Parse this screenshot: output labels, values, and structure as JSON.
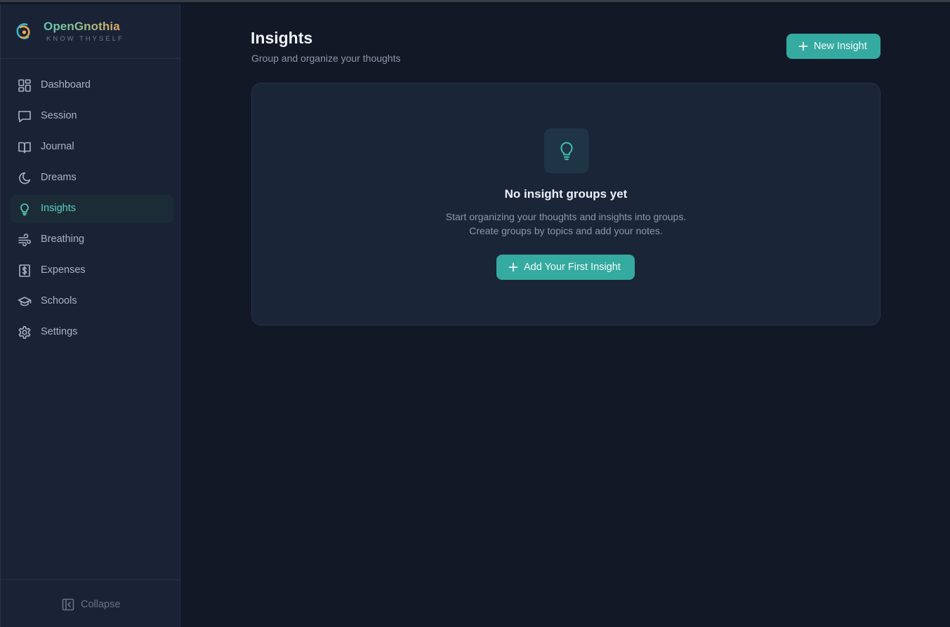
{
  "app": {
    "name": "OpenGnothia",
    "tagline": "KNOW THYSELF"
  },
  "sidebar": {
    "items": [
      {
        "label": "Dashboard",
        "icon": "dashboard-icon"
      },
      {
        "label": "Session",
        "icon": "chat-icon"
      },
      {
        "label": "Journal",
        "icon": "book-icon"
      },
      {
        "label": "Dreams",
        "icon": "moon-icon"
      },
      {
        "label": "Insights",
        "icon": "lightbulb-icon",
        "active": true
      },
      {
        "label": "Breathing",
        "icon": "wind-icon"
      },
      {
        "label": "Expenses",
        "icon": "receipt-dollar-icon"
      },
      {
        "label": "Schools",
        "icon": "graduation-cap-icon"
      },
      {
        "label": "Settings",
        "icon": "gear-icon"
      }
    ],
    "collapse_label": "Collapse"
  },
  "page": {
    "title": "Insights",
    "subtitle": "Group and organize your thoughts",
    "new_button": "New Insight"
  },
  "empty_state": {
    "icon": "lightbulb-icon",
    "title": "No insight groups yet",
    "line1": "Start organizing your thoughts and insights into groups.",
    "line2": "Create groups by topics and add your notes.",
    "button": "Add Your First Insight"
  },
  "colors": {
    "accent": "#35aaa0",
    "active_text": "#5ecfc1",
    "background": "#121826",
    "sidebar": "#1a2336",
    "card": "#1b2538"
  }
}
